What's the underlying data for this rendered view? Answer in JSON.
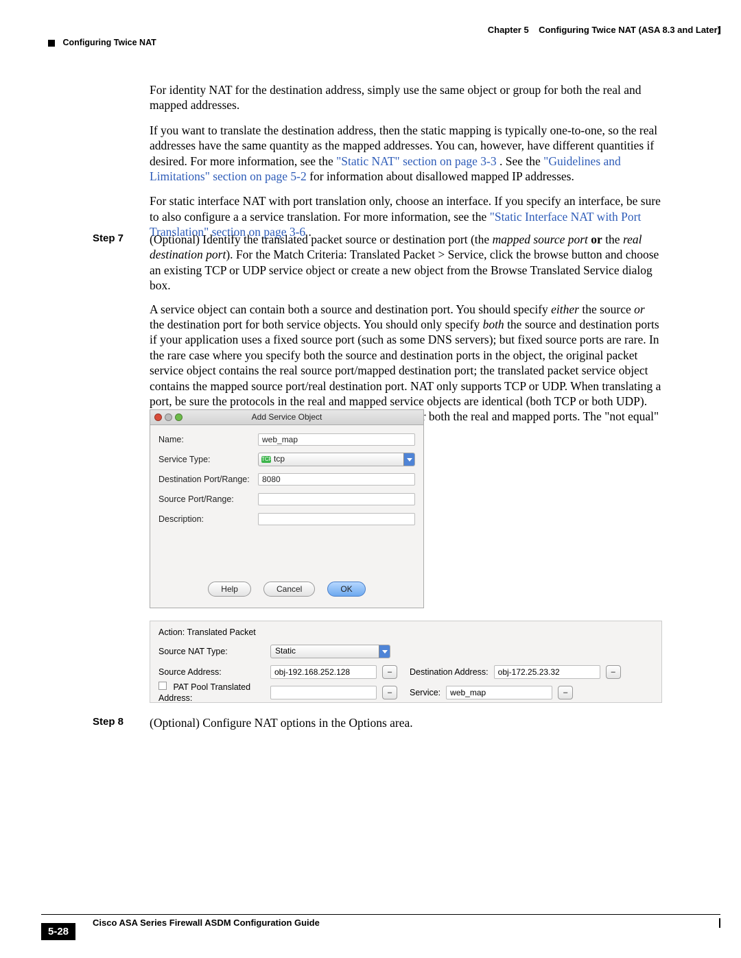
{
  "header": {
    "chapter": "Chapter 5",
    "chapter_title": "Configuring Twice NAT (ASA 8.3 and Later)",
    "section": "Configuring Twice NAT"
  },
  "body": {
    "p1": "For identity NAT for the destination address, simply use the same object or group for both the real and mapped addresses.",
    "p2a": "If you want to translate the destination address, then the static mapping is typically one-to-one, so the real addresses have the same quantity as the mapped addresses. You can, however, have different quantities if desired. For more information, see the ",
    "link1": "\"Static NAT\" section on page 3-3",
    "p2b": ". See the ",
    "link2": "\"Guidelines and Limitations\" section on page 5-2",
    "p2c": " for information about disallowed mapped IP addresses.",
    "p3a": "For static interface NAT with port translation only, choose an interface. If you specify an interface, be sure to also configure a a service translation. For more information, see the ",
    "link3": "\"Static Interface NAT with Port Translation\" section on page 3-6",
    "p3b": "."
  },
  "step7": {
    "label": "Step 7",
    "p1a": "(Optional) Identify the translated packet source or destination port (the ",
    "p1_i1": "mapped source port",
    "p1b": " or ",
    "p1_b1": "or",
    "p1c": " the ",
    "p1_i2": "real destination port",
    "p1d": "). For the Match Criteria: Translated Packet > Service, click the browse button and choose an existing TCP or UDP service object or create a new object from the Browse Translated Service dialog box.",
    "p2": "A service object can contain both a source and destination port. You should specify either the source or the destination port for both service objects. You should only specify both the source and destination ports if your application uses a fixed source port (such as some DNS servers); but fixed source ports are rare. In the rare case where you specify both the source and destination ports in the object, the original packet service object contains the real source port/mapped destination port; the translated packet service object contains the mapped source port/real destination port. NAT only supports TCP or UDP. When translating a port, be sure the protocols in the real and mapped service objects are identical (both TCP or both UDP). For identity NAT, you can use the same service object for both the real and mapped ports. The \"not equal\" (!=) operator is not supported."
  },
  "dialog": {
    "title": "Add Service Object",
    "name_label": "Name:",
    "name_value": "web_map",
    "service_type_label": "Service Type:",
    "service_type_value": "tcp",
    "dest_port_label": "Destination Port/Range:",
    "dest_port_value": "8080",
    "src_port_label": "Source Port/Range:",
    "src_port_value": "",
    "desc_label": "Description:",
    "desc_value": "",
    "help": "Help",
    "cancel": "Cancel",
    "ok": "OK"
  },
  "panel": {
    "title": "Action: Translated Packet",
    "src_nat_type_label": "Source NAT Type:",
    "src_nat_type_value": "Static",
    "src_addr_label": "Source Address:",
    "src_addr_value": "obj-192.168.252.128",
    "dest_addr_label": "Destination Address:",
    "dest_addr_value": "obj-172.25.23.32",
    "pat_label": "PAT Pool Translated Address:",
    "pat_value": "",
    "service_label": "Service:",
    "service_value": "web_map",
    "browse": "–"
  },
  "step8": {
    "label": "Step 8",
    "text": "(Optional) Configure NAT options in the Options area."
  },
  "footer": {
    "guide": "Cisco ASA Series Firewall ASDM Configuration Guide",
    "page": "5-28"
  }
}
